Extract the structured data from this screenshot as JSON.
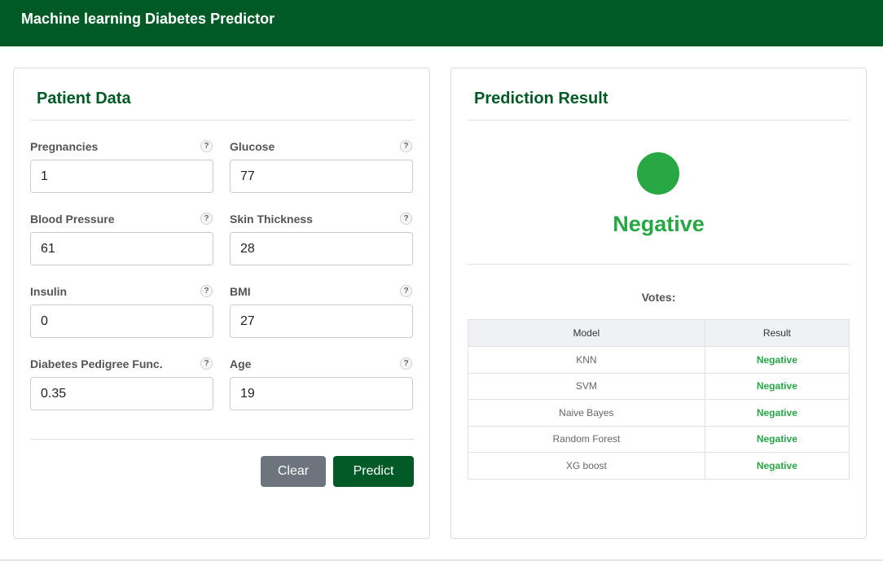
{
  "app": {
    "title": "Machine learning Diabetes Predictor"
  },
  "patient": {
    "title": "Patient Data",
    "help_symbol": "?",
    "fields": [
      {
        "label": "Pregnancies",
        "value": "1"
      },
      {
        "label": "Glucose",
        "value": "77"
      },
      {
        "label": "Blood Pressure",
        "value": "61"
      },
      {
        "label": "Skin Thickness",
        "value": "28"
      },
      {
        "label": "Insulin",
        "value": "0"
      },
      {
        "label": "BMI",
        "value": "27"
      },
      {
        "label": "Diabetes Pedigree Func.",
        "value": "0.35"
      },
      {
        "label": "Age",
        "value": "19"
      }
    ],
    "clear_label": "Clear",
    "predict_label": "Predict"
  },
  "prediction": {
    "title": "Prediction Result",
    "result": "Negative",
    "result_color": "#28a745",
    "votes_label": "Votes:",
    "headers": {
      "model": "Model",
      "result": "Result"
    },
    "rows": [
      {
        "model": "KNN",
        "result": "Negative"
      },
      {
        "model": "SVM",
        "result": "Negative"
      },
      {
        "model": "Naive Bayes",
        "result": "Negative"
      },
      {
        "model": "Random Forest",
        "result": "Negative"
      },
      {
        "model": "XG boost",
        "result": "Negative"
      }
    ]
  },
  "colors": {
    "brand": "#005a26",
    "clear_button": "#6c757d",
    "positive_green": "#28a745"
  }
}
